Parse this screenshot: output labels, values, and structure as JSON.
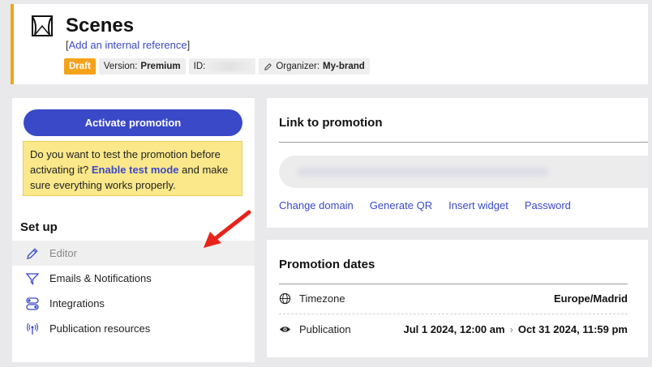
{
  "header": {
    "title": "Scenes",
    "ref_prefix": "[",
    "ref_link": "Add an internal reference",
    "ref_suffix": "]",
    "badge_draft": "Draft",
    "badge_version_label": "Version:",
    "badge_version_value": "Premium",
    "badge_id_label": "ID:",
    "badge_organizer_label": "Organizer:",
    "badge_organizer_value": "My-brand",
    "accent_color": "#f0a51c"
  },
  "left_panel": {
    "activate_label": "Activate promotion",
    "notice_text_1": "Do you want to test the promotion before activating it?",
    "notice_link": "Enable test mode",
    "notice_text_2": "and make sure everything works properly.",
    "setup_title": "Set up",
    "menu_items": [
      {
        "label": "Editor",
        "icon": "pencil-icon"
      },
      {
        "label": "Emails & Notifications",
        "icon": "send-icon"
      },
      {
        "label": "Integrations",
        "icon": "toggle-icon"
      },
      {
        "label": "Publication resources",
        "icon": "broadcast-icon"
      }
    ]
  },
  "link_card": {
    "title": "Link to promotion",
    "actions": [
      "Change domain",
      "Generate QR",
      "Insert widget",
      "Password"
    ]
  },
  "dates_card": {
    "title": "Promotion dates",
    "timezone_label": "Timezone",
    "timezone_value": "Europe/Madrid",
    "publication_label": "Publication",
    "publication_start": "Jul 1 2024, 12:00 am",
    "publication_end": "Oct 31 2024, 11:59 pm"
  },
  "colors": {
    "primary": "#3a49c7",
    "draft": "#f5a21b",
    "notice_bg": "#fbe88a",
    "arrow": "#e8231a"
  }
}
